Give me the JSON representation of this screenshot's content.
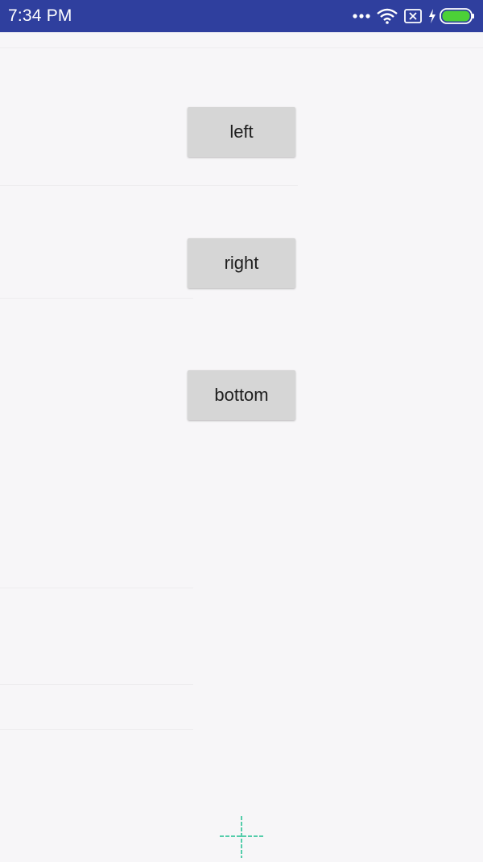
{
  "status_bar": {
    "time": "7:34  PM",
    "bg_color": "#2f3f9e",
    "icons": [
      "more-dots-icon",
      "wifi-icon",
      "no-sim-icon",
      "charging-bolt-icon",
      "battery-icon"
    ],
    "battery_color": "#4cd137"
  },
  "buttons": {
    "left_label": "left",
    "right_label": "right",
    "bottom_label": "bottom"
  },
  "touch_indicator": {
    "icon": "touch-crosshair-icon",
    "color": "#1fbf8f"
  }
}
